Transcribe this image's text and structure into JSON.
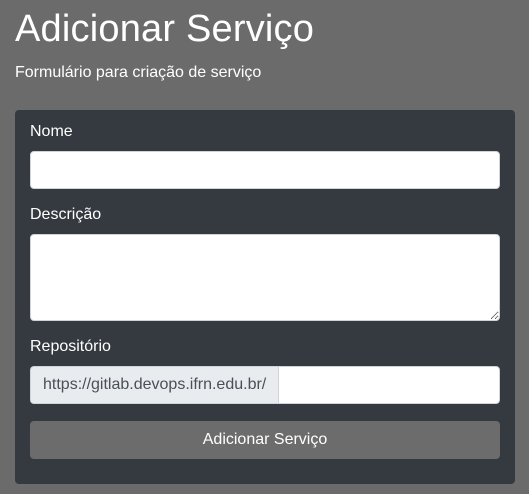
{
  "header": {
    "title": "Adicionar Serviço",
    "subtitle": "Formulário para criação de serviço"
  },
  "form": {
    "name": {
      "label": "Nome",
      "value": "",
      "placeholder": ""
    },
    "description": {
      "label": "Descrição",
      "value": "",
      "placeholder": ""
    },
    "repository": {
      "label": "Repositório",
      "prefix": "https://gitlab.devops.ifrn.edu.br/",
      "value": "",
      "placeholder": ""
    },
    "submit_label": "Adicionar Serviço"
  },
  "colors": {
    "page_background": "#6b6b6b",
    "card_background": "#343a40",
    "button_background": "#6c6c6c",
    "prefix_background": "#e9ecef"
  }
}
